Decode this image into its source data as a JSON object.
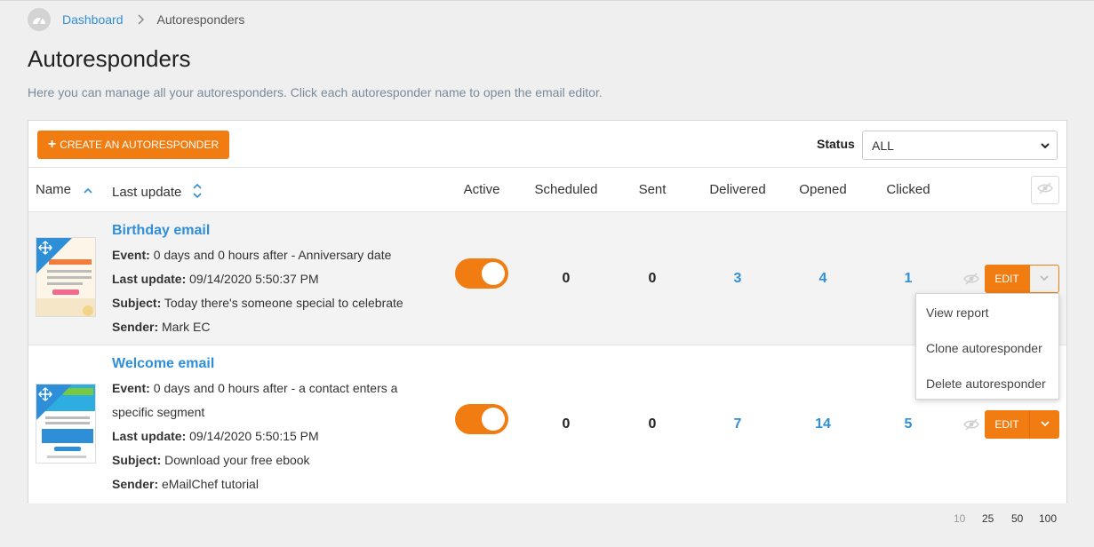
{
  "breadcrumb": {
    "home_link": "Dashboard",
    "current": "Autoresponders"
  },
  "page": {
    "title": "Autoresponders",
    "description": "Here you can manage all your autoresponders. Click each autoresponder name to open the email editor."
  },
  "toolbar": {
    "create_label": "CREATE AN AUTORESPONDER",
    "status_label": "Status",
    "status_value": "ALL"
  },
  "columns": {
    "name": "Name",
    "last_update": "Last update",
    "active": "Active",
    "scheduled": "Scheduled",
    "sent": "Sent",
    "delivered": "Delivered",
    "opened": "Opened",
    "clicked": "Clicked"
  },
  "rows": [
    {
      "name": "Birthday email",
      "event_label": "Event:",
      "event": "0 days and 0 hours after - Anniversary date",
      "last_update_label": "Last update:",
      "last_update": "09/14/2020 5:50:37 PM",
      "subject_label": "Subject:",
      "subject": "Today there's someone special to celebrate",
      "sender_label": "Sender:",
      "sender": "Mark EC",
      "active": true,
      "scheduled": "0",
      "sent": "0",
      "delivered": "3",
      "opened": "4",
      "clicked": "1",
      "edit_label": "EDIT"
    },
    {
      "name": "Welcome email",
      "event_label": "Event:",
      "event_line1": "0 days and 0 hours after - a contact enters a",
      "event_line2": "specific segment",
      "last_update_label": "Last update:",
      "last_update": "09/14/2020 5:50:15 PM",
      "subject_label": "Subject:",
      "subject": "Download your free ebook",
      "sender_label": "Sender:",
      "sender": "eMailChef tutorial",
      "active": true,
      "scheduled": "0",
      "sent": "0",
      "delivered": "7",
      "opened": "14",
      "clicked": "5",
      "edit_label": "EDIT"
    }
  ],
  "dropdown_menu": [
    "View report",
    "Clone autoresponder",
    "Delete autoresponder"
  ],
  "pagination": {
    "options": [
      "10",
      "25",
      "50",
      "100"
    ],
    "selected": "10"
  },
  "icons": {
    "home": "dashboard-gauge-icon",
    "separator": "chevron-right-icon",
    "sort_name": "sort-asc-icon",
    "sort_update": "sort-both-icon",
    "eye": "eye-slash-icon",
    "move": "move-arrows-icon",
    "caret": "chevron-down-icon"
  },
  "colors": {
    "accent": "#f07c12",
    "link": "#2f8fd8",
    "background": "#efefef"
  }
}
